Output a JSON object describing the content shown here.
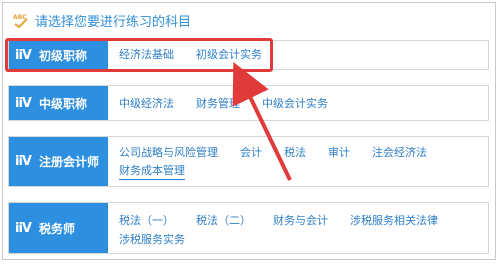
{
  "header": {
    "title": "请选择您要进行练习的科目",
    "icon": "abc-pencil-icon"
  },
  "accent_color": "#2d8fe0",
  "highlight_color": "#e03a3a",
  "rows": [
    {
      "logo": "iiV",
      "label": "初级职称",
      "lines": [
        [
          "经济法基础",
          "初级会计实务"
        ]
      ]
    },
    {
      "logo": "iiV",
      "label": "中级职称",
      "lines": [
        [
          "中级经济法",
          "财务管理",
          "中级会计实务"
        ]
      ]
    },
    {
      "logo": "iiV",
      "label": "注册会计师",
      "lines": [
        [
          "公司战略与风险管理",
          "会计",
          "税法",
          "审计",
          "注会经济法"
        ],
        [
          "财务成本管理"
        ]
      ]
    },
    {
      "logo": "iiV",
      "label": "税务师",
      "lines": [
        [
          "税法（一）",
          "税法（二）",
          "财务与会计",
          "涉税服务相关法律"
        ],
        [
          "涉税服务实务"
        ]
      ]
    }
  ]
}
